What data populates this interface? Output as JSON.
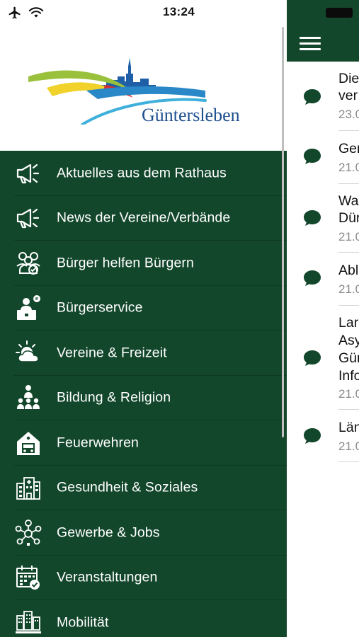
{
  "status_bar": {
    "time": "13:24"
  },
  "drawer": {
    "logo_text": "Güntersleben",
    "menu_items": [
      {
        "label": "Aktuelles aus dem Rathaus",
        "icon": "megaphone-icon"
      },
      {
        "label": "News der Vereine/Verbände",
        "icon": "megaphone-icon"
      },
      {
        "label": "Bürger helfen Bürgern",
        "icon": "community-help-icon"
      },
      {
        "label": "Bürgerservice",
        "icon": "citizen-service-desk-icon"
      },
      {
        "label": "Vereine & Freizeit",
        "icon": "sun-cloud-icon"
      },
      {
        "label": "Bildung & Religion",
        "icon": "teacher-class-icon"
      },
      {
        "label": "Feuerwehren",
        "icon": "fire-station-icon"
      },
      {
        "label": "Gesundheit & Soziales",
        "icon": "hospital-building-icon"
      },
      {
        "label": "Gewerbe & Jobs",
        "icon": "business-network-icon"
      },
      {
        "label": "Veranstaltungen",
        "icon": "calendar-check-icon"
      },
      {
        "label": "Mobilität",
        "icon": "city-mobility-icon"
      }
    ]
  },
  "content": {
    "news": [
      {
        "title_lines": [
          "Die",
          "ver"
        ],
        "date": "23.0"
      },
      {
        "title_lines": [
          "Ger"
        ],
        "date": "21.0"
      },
      {
        "title_lines": [
          "Wa",
          "Dür"
        ],
        "date": "21.0"
      },
      {
        "title_lines": [
          "Abl"
        ],
        "date": "21.0"
      },
      {
        "title_lines": [
          "Lar",
          "Asy",
          "Gür",
          "Info"
        ],
        "date": "21.0"
      },
      {
        "title_lines": [
          "Län"
        ],
        "date": "21.0"
      }
    ]
  },
  "colors": {
    "brand_green": "#13472b",
    "separator": "#0e3a22",
    "logo_blue": "#1e4f8f"
  }
}
